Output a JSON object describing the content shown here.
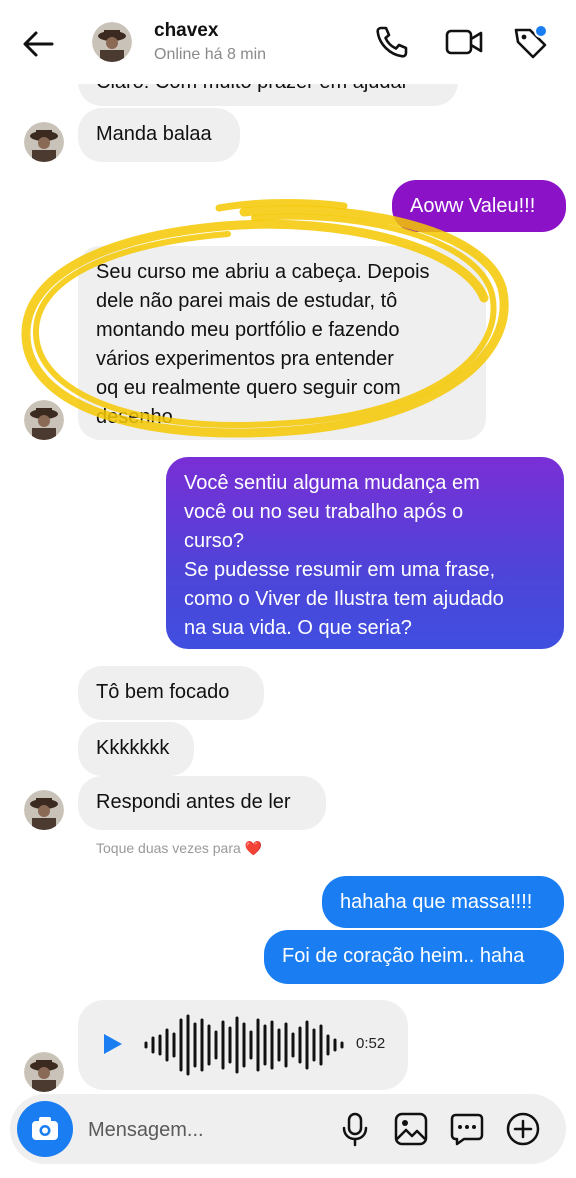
{
  "header": {
    "name": "chavex",
    "status": "Online há 8 min",
    "status_dot_color": "#1a7ef2"
  },
  "messages": {
    "partial_top": "Claro! Com muito prazer em ajudar",
    "manda": "Manda balaa",
    "valeu": "Aoww Valeu!!!",
    "curso": "Seu curso me abriu a cabeça. Depois\ndele não parei mais de estudar, tô\nmontando meu portfólio e fazendo\nvários experimentos pra entender\noq eu realmente quero seguir com\ndesenho",
    "pergunta": "Você sentiu alguma mudança em\nvocê ou no seu trabalho após o\ncurso?\nSe pudesse resumir em uma frase,\ncomo o Viver de Ilustra tem ajudado\nna sua vida. O que seria?",
    "focado": "Tô bem focado",
    "kkk": "Kkkkkkk",
    "respondi": "Respondi antes de ler",
    "hint": "Toque duas vezes para ❤️",
    "massa": "hahaha que massa!!!!",
    "coracao": "Foi de coração heim.. haha"
  },
  "voice": {
    "duration": "0:52"
  },
  "composer": {
    "placeholder": "Mensagem..."
  },
  "icons": {
    "back": "arrow-left-icon",
    "phone": "phone-icon",
    "video": "video-camera-icon",
    "tag": "tag-icon",
    "camera": "camera-icon",
    "mic": "microphone-icon",
    "gallery": "image-icon",
    "sticker": "chat-bubble-icon",
    "add": "plus-circle-icon",
    "play": "play-icon"
  },
  "colors": {
    "purple_bubble": "#8c12c8",
    "blue_bubble": "#1a7ef2",
    "gradient_top": "#7a2fd6",
    "gradient_bottom": "#3f4fe0",
    "highlight": "#f5c800"
  }
}
